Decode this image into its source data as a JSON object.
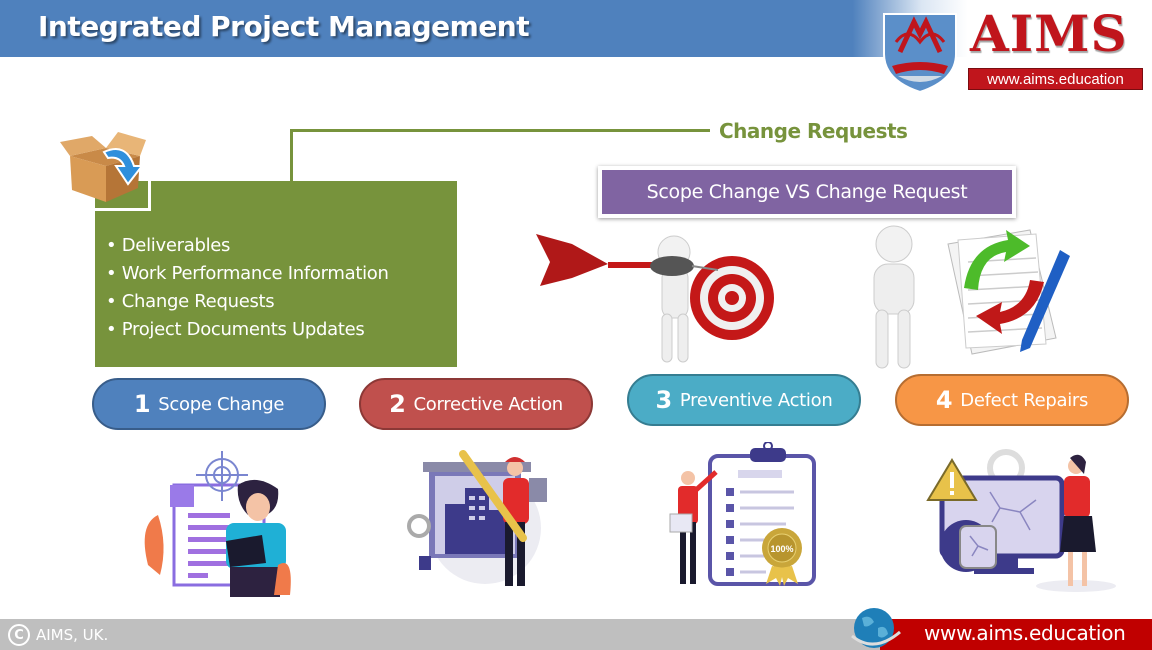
{
  "header": {
    "title": "Integrated Project Management",
    "bar_color": "#4f81bd"
  },
  "logo": {
    "brand": "AIMS",
    "url": "www.aims.education",
    "brand_color": "#c0151c"
  },
  "connector": {
    "label": "Change Requests",
    "color": "#77933c"
  },
  "outputs_box": {
    "color": "#77933c",
    "icon": "open-box-download-icon",
    "items": [
      "Deliverables",
      "Work Performance Information",
      "Change Requests",
      "Project Documents Updates"
    ]
  },
  "banner": {
    "label": "Scope Change VS Change Request",
    "color": "#8064a2"
  },
  "illustrations": {
    "dart_target": "figure-with-dart-and-target-illustration",
    "figure_documents": "figure-with-edited-documents-illustration"
  },
  "change_types": [
    {
      "number": "1",
      "label": "Scope Change",
      "color": "#4f81bd",
      "illustration": "person-reading-with-target-illustration"
    },
    {
      "number": "2",
      "label": "Corrective Action",
      "color": "#c0504d",
      "illustration": "worker-with-wrench-illustration"
    },
    {
      "number": "3",
      "label": "Preventive Action",
      "color": "#4bacc6",
      "illustration": "checklist-clipboard-100-percent-illustration"
    },
    {
      "number": "4",
      "label": "Defect Repairs",
      "color": "#f79646",
      "illustration": "cracked-screen-warning-illustration"
    }
  ],
  "footer": {
    "copyright_symbol": "C",
    "copyright_text": "AIMS, UK.",
    "url": "www.aims.education",
    "accent_color": "#c00000"
  }
}
